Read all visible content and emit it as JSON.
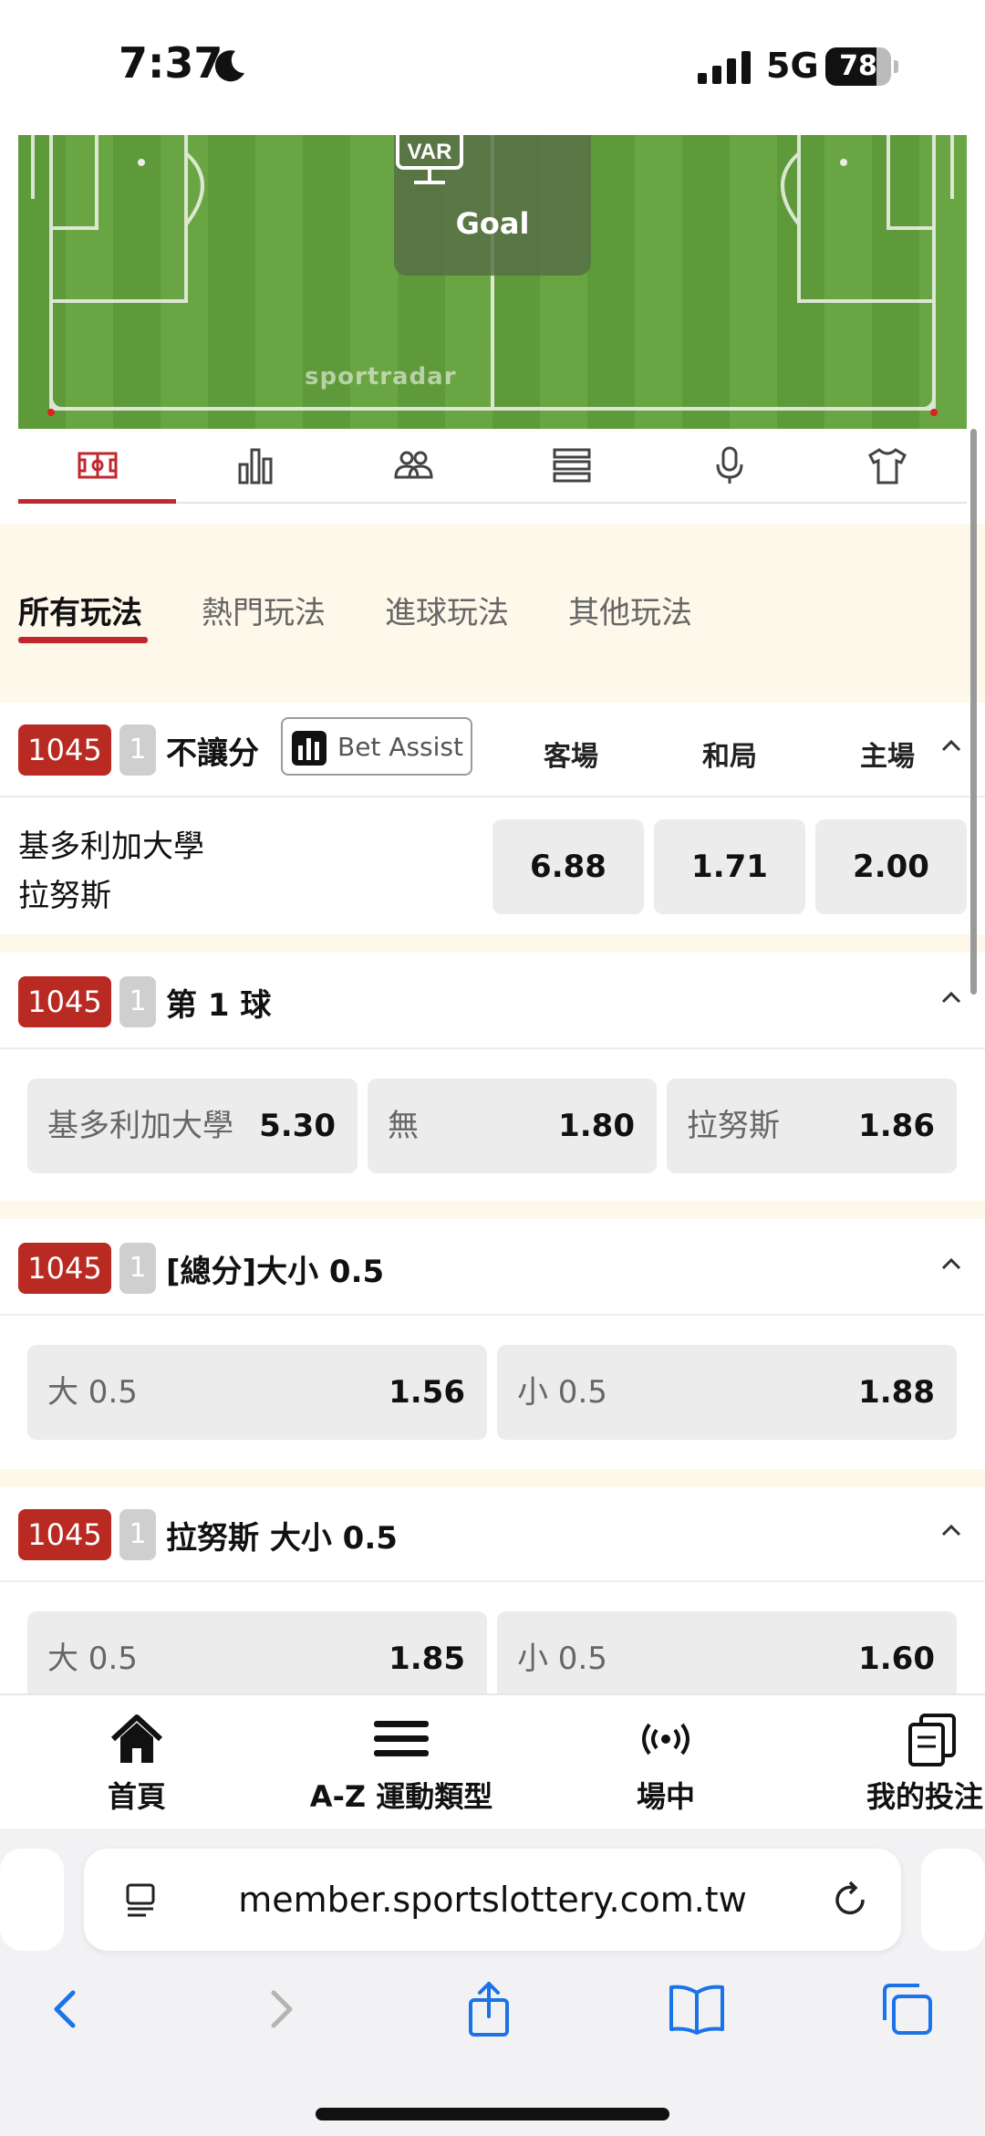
{
  "status_bar": {
    "time": "7:37",
    "network": "5G",
    "battery": "78",
    "battery_level": 0.78
  },
  "pitch": {
    "var_label": "VAR",
    "event": "Goal",
    "brand": "sportradar"
  },
  "stat_tabs": [
    "pitch-icon",
    "bar-chart-icon",
    "players-icon",
    "list-icon",
    "microphone-icon",
    "jersey-icon"
  ],
  "categories": [
    {
      "label": "所有玩法",
      "active": true
    },
    {
      "label": "熱門玩法"
    },
    {
      "label": "進球玩法"
    },
    {
      "label": "其他玩法"
    }
  ],
  "markets": [
    {
      "code": "1045",
      "num": "1",
      "title": "不讓分",
      "bet_assist": "Bet Assist",
      "columns": [
        "客場",
        "和局",
        "主場"
      ],
      "teams": [
        "基多利加大學",
        "拉努斯"
      ],
      "odds": [
        "6.88",
        "1.71",
        "2.00"
      ]
    },
    {
      "code": "1045",
      "num": "1",
      "title": "第 1 球",
      "options": [
        {
          "label": "基多利加大學",
          "odd": "5.30"
        },
        {
          "label": "無",
          "odd": "1.80"
        },
        {
          "label": "拉努斯",
          "odd": "1.86"
        }
      ]
    },
    {
      "code": "1045",
      "num": "1",
      "title": "[總分]大小 0.5",
      "options": [
        {
          "label": "大 0.5",
          "odd": "1.56"
        },
        {
          "label": "小 0.5",
          "odd": "1.88"
        }
      ]
    },
    {
      "code": "1045",
      "num": "1",
      "title": "拉努斯 大小 0.5",
      "options": [
        {
          "label": "大 0.5",
          "odd": "1.85"
        },
        {
          "label": "小 0.5",
          "odd": "1.60"
        }
      ]
    }
  ],
  "bottom_nav": [
    "首頁",
    "A-Z 運動類型",
    "場中",
    "我的投注"
  ],
  "browser": {
    "url": "member.sportslottery.com.tw"
  },
  "colors": {
    "accent": "#c0282e",
    "badge": "#b92a22",
    "cream": "#fdf8ea",
    "odd_button": "#ececec"
  }
}
